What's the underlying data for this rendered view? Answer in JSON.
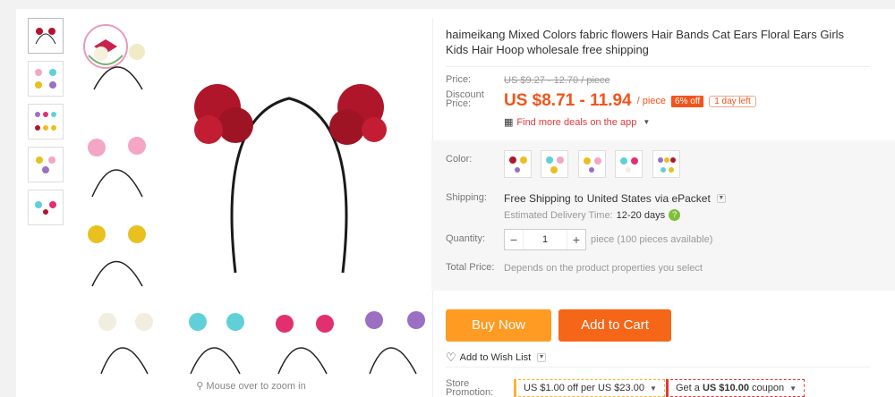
{
  "product": {
    "title": "haimeikang Mixed Colors fabric flowers Hair Bands Cat Ears Floral Ears Girls Kids Hair Hoop wholesale free shipping"
  },
  "gallery": {
    "zoom_hint": "Mouse over to zoom in",
    "thumbnail_icon": "headband-image",
    "accent_colors": [
      "#b0162a",
      "#f3a6c6",
      "#e8c020",
      "#f1eee0",
      "#5fd0d8",
      "#e2306f",
      "#9b6fc2"
    ]
  },
  "price": {
    "label": "Price:",
    "original": "US $9.27 - 12.70 / piece",
    "discount_label_1": "Discount",
    "discount_label_2": "Price:",
    "current": "US $8.71 - 11.94",
    "per": "/ piece",
    "off_badge": "6% off",
    "days_left": "1 day left",
    "app_deals": "Find more deals on the app"
  },
  "options": {
    "color_label": "Color:",
    "shipping_label": "Shipping:",
    "shipping_prefix": "Free Shipping",
    "shipping_to": "to",
    "shipping_country": "United States",
    "shipping_via": "via ePacket",
    "delivery_label": "Estimated Delivery Time:",
    "delivery_value": "12-20 days",
    "quantity_label": "Quantity:",
    "quantity_value": "1",
    "quantity_note": "piece (100 pieces available)",
    "total_label": "Total Price:",
    "total_value": "Depends on the product properties you select"
  },
  "actions": {
    "buy_now": "Buy Now",
    "add_to_cart": "Add to Cart",
    "wish_list": "Add to Wish List"
  },
  "promotion": {
    "label_1": "Store",
    "label_2": "Promotion:",
    "coupon_1": "US $1.00 off per US $23.00",
    "coupon_2_prefix": "Get a",
    "coupon_2_amount": "US $10.00",
    "coupon_2_suffix": "coupon"
  }
}
